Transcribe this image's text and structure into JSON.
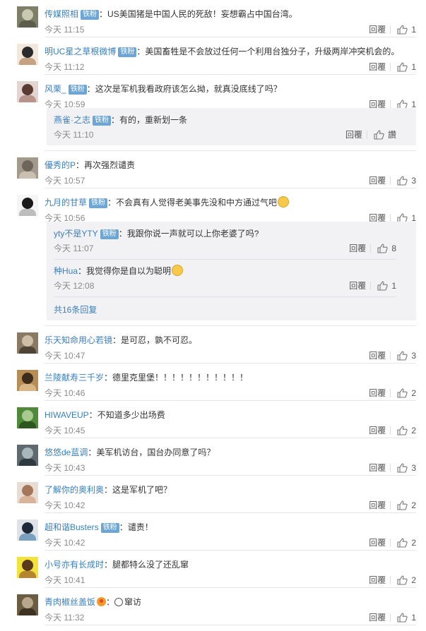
{
  "reply_label": "回覆",
  "badge_label": "铁粉",
  "colors": {
    "link": "#3a7fbd",
    "badge": "#6da6d4",
    "sub_bg": "#f2f2f5",
    "divider": "#e6e6e6"
  },
  "comments": [
    {
      "user": "传媒照相",
      "badge": true,
      "sep": "：",
      "text": "US美国猪是中国人民的死敌！妄想霸占中国台湾。",
      "time": "今天 11:15",
      "likes": "1",
      "avatar_colors": [
        "#7f7f68",
        "#c9c8b0",
        "#5d5d4d"
      ]
    },
    {
      "user": "明UC星之草根微博",
      "badge": true,
      "sep": "：",
      "text": "美国畜牲是不会放过任何一个利用台独分子，升级两岸冲突机会的。",
      "time": "今天 11:12",
      "likes": "1",
      "avatar_colors": [
        "#f1e7dd",
        "#2b2b2b",
        "#c7a282"
      ]
    },
    {
      "user": "风栗_",
      "badge": true,
      "sep": "：",
      "text": "这次是军机我看政府该怎么拗，就真没底线了吗？",
      "time": "今天 10:59",
      "likes": "1",
      "avatar_colors": [
        "#e3d6d2",
        "#5a3a33",
        "#b8938a"
      ],
      "replies": [
        {
          "user": "燕雀·之志",
          "badge": true,
          "sep": "：",
          "text": "有的，重新划一条",
          "time": "今天 11:10",
          "likes": "讚"
        }
      ]
    },
    {
      "user": "優秀的P",
      "badge": false,
      "sep": "：",
      "text": "再次强烈谴责",
      "time": "今天 10:57",
      "likes": "3",
      "avatar_colors": [
        "#a49a8c",
        "#6d655a",
        "#c9c0b2"
      ]
    },
    {
      "user": "九月的甘草",
      "badge": true,
      "sep": "：",
      "text": "不会真有人觉得老美事先没和中方通过气吧",
      "emoji": true,
      "time": "今天 10:56",
      "likes": "1",
      "avatar_colors": [
        "#f5f5f5",
        "#1b1b1b",
        "#bdbdbd"
      ],
      "replies": [
        {
          "user": "yty不是YTY",
          "badge": true,
          "sep": "：",
          "text": "我跟你说一声就可以上你老婆了吗?",
          "time": "今天 11:07",
          "likes": "8"
        },
        {
          "user": "种Hua",
          "badge": false,
          "sep": "：",
          "text": "我觉得你是自以为聪明",
          "emoji": true,
          "time": "今天 12:08",
          "likes": "1"
        }
      ],
      "more": "共16条回复"
    },
    {
      "user": "乐天知命用心若镜",
      "badge": false,
      "sep": "：",
      "text": "是可忍，孰不可忍。",
      "time": "今天 10:47",
      "likes": "3",
      "avatar_colors": [
        "#8a7a64",
        "#cdbfa5",
        "#4e4536"
      ]
    },
    {
      "user": "兰陵献寿三千岁",
      "badge": false,
      "sep": "：",
      "text": "德里克里堡！！！！！！！！！！！",
      "time": "今天 10:46",
      "likes": "2",
      "avatar_colors": [
        "#b78d56",
        "#3b2c1c",
        "#d8b684"
      ]
    },
    {
      "user": "HIWAVEUP",
      "badge": false,
      "sep": "：",
      "text": "不知道多少出场费",
      "time": "今天 10:45",
      "likes": "2",
      "avatar_colors": [
        "#4f8a3a",
        "#a8c98f",
        "#2d5520"
      ]
    },
    {
      "user": "悠悠de蓝调",
      "badge": false,
      "sep": "：",
      "text": "美军机访台，国台办同意了吗？",
      "time": "今天 10:43",
      "likes": "3",
      "avatar_colors": [
        "#5e6a70",
        "#a9b7bd",
        "#2e3a40"
      ]
    },
    {
      "user": "了解你的奥利奥",
      "badge": false,
      "sep": "：",
      "text": "这是军机了吧？",
      "time": "今天 10:42",
      "likes": "2",
      "avatar_colors": [
        "#e8ddd4",
        "#a6765a",
        "#d9b49a"
      ]
    },
    {
      "user": "超和谐Busters",
      "badge": true,
      "sep": "：",
      "text": "谴责！",
      "time": "今天 10:42",
      "likes": "2",
      "avatar_colors": [
        "#dfe3e8",
        "#1e2a3a",
        "#7aa0c0"
      ]
    },
    {
      "user": "小号亦有长成时",
      "badge": false,
      "sep": "：",
      "text": "腿都特么没了还乱窜",
      "time": "今天 10:41",
      "likes": "2",
      "avatar_colors": [
        "#f3e23a",
        "#5a3a1a",
        "#b5852f"
      ]
    },
    {
      "user": "青肉椒丝盖饭",
      "badge": false,
      "vip": true,
      "sep": "：",
      "text": "窜访",
      "scared": true,
      "time": "今天 11:32",
      "likes": "1",
      "avatar_colors": [
        "#6b5c44",
        "#b8a78a",
        "#3e3322"
      ]
    }
  ]
}
